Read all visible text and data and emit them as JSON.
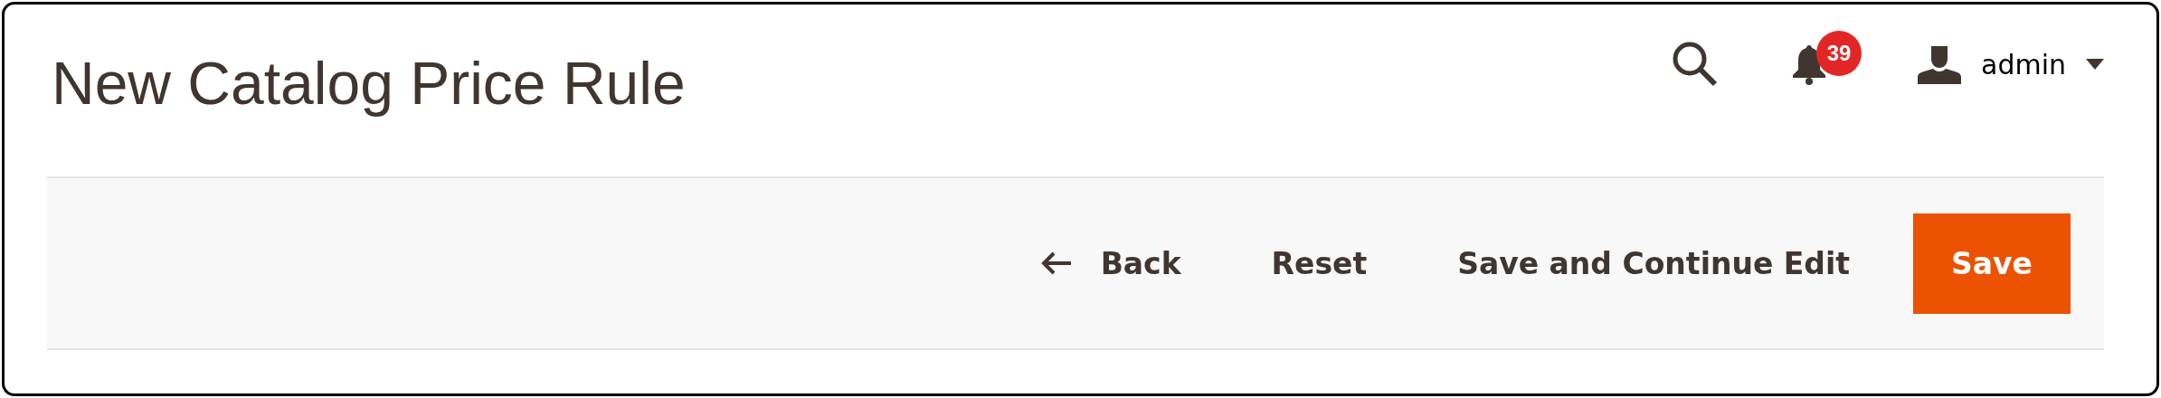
{
  "page_title": "New Catalog Price Rule",
  "header": {
    "notifications": {
      "count": "39"
    },
    "user": {
      "name": "admin"
    }
  },
  "toolbar": {
    "buttons": [
      {
        "kind": "back",
        "label": "Back"
      },
      {
        "kind": "plain",
        "label": "Reset"
      },
      {
        "kind": "plain",
        "label": "Save and Continue Edit"
      },
      {
        "kind": "primary",
        "label": "Save"
      }
    ]
  }
}
